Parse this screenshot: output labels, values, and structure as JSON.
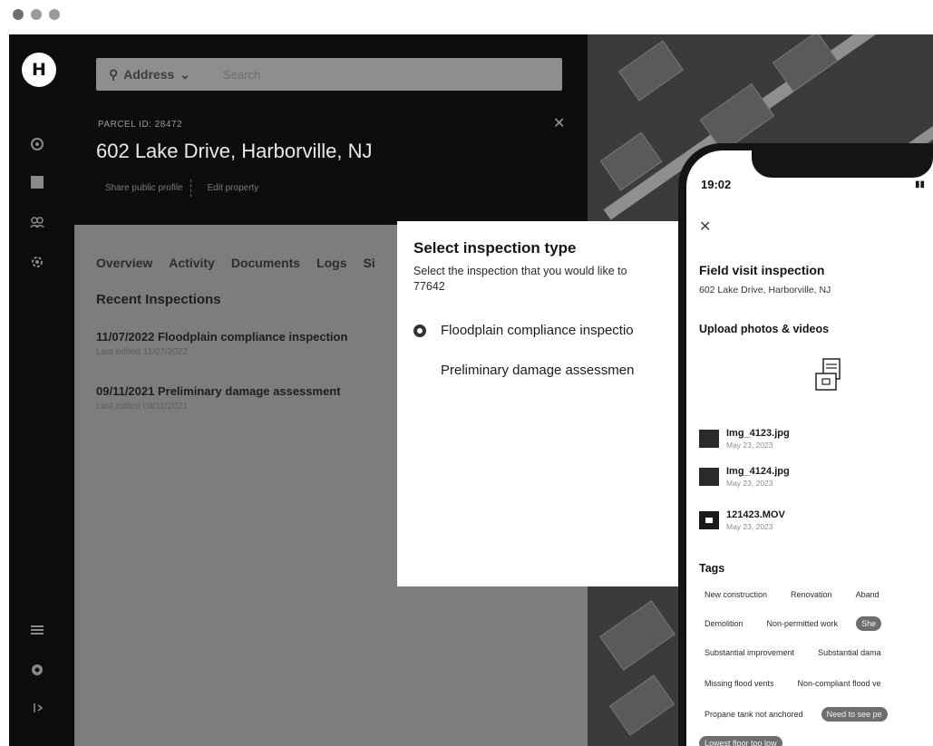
{
  "sidebar": {
    "avatar_letter": "H"
  },
  "property": {
    "search_scope": "Address",
    "search_placeholder": "Search",
    "parcel_id": "PARCEL ID: 28472",
    "address_title": "602 Lake Drive, Harborville, NJ",
    "actions": [
      "Share public profile",
      "Edit property"
    ],
    "tabs": [
      "Overview",
      "Activity",
      "Documents",
      "Logs",
      "Si"
    ],
    "recent_title": "Recent Inspections",
    "inspections": [
      {
        "title": "11/07/2022 Floodplain compliance inspection",
        "sub": "Last edited 11/07/2022"
      },
      {
        "title": "09/11/2021 Preliminary damage assessment",
        "sub": "Last edited 09/11/2021"
      }
    ]
  },
  "modal": {
    "title": "Select inspection type",
    "description": "Select the inspection that you would like to",
    "description_id": "77642",
    "options": [
      {
        "label": "Floodplain compliance inspectio",
        "selected": true
      },
      {
        "label": "Preliminary damage assessmen",
        "selected": false
      }
    ]
  },
  "phone": {
    "time": "19:02",
    "close_icon": "close-icon",
    "title": "Field visit inspection",
    "address": "602 Lake Drive, Harborville, NJ",
    "upload_label": "Upload photos & videos",
    "files": [
      {
        "name": "Img_4123.jpg",
        "date": "May 23, 2023",
        "kind": "image"
      },
      {
        "name": "Img_4124.jpg",
        "date": "May 23, 2023",
        "kind": "image"
      },
      {
        "name": "121423.MOV",
        "date": "May 23, 2023",
        "kind": "video"
      }
    ],
    "tags_label": "Tags",
    "tag_rows": [
      [
        {
          "label": "New construction",
          "selected": false
        },
        {
          "label": "Renovation",
          "selected": false
        },
        {
          "label": "Aband",
          "selected": false
        }
      ],
      [
        {
          "label": "Demolition",
          "selected": false
        },
        {
          "label": "Non-permitted work",
          "selected": false
        },
        {
          "label": "She",
          "selected": true
        }
      ],
      [
        {
          "label": "Substantial improvement",
          "selected": false
        },
        {
          "label": "Substantial dama",
          "selected": false
        }
      ],
      [
        {
          "label": "Missing flood vents",
          "selected": false
        },
        {
          "label": "Non-compliant flood ve",
          "selected": false
        }
      ],
      [
        {
          "label": "Propane tank not anchored",
          "selected": false
        },
        {
          "label": "Need to see pe",
          "selected": true
        }
      ],
      [
        {
          "label": "Lowest floor too low",
          "selected": true
        }
      ]
    ]
  }
}
